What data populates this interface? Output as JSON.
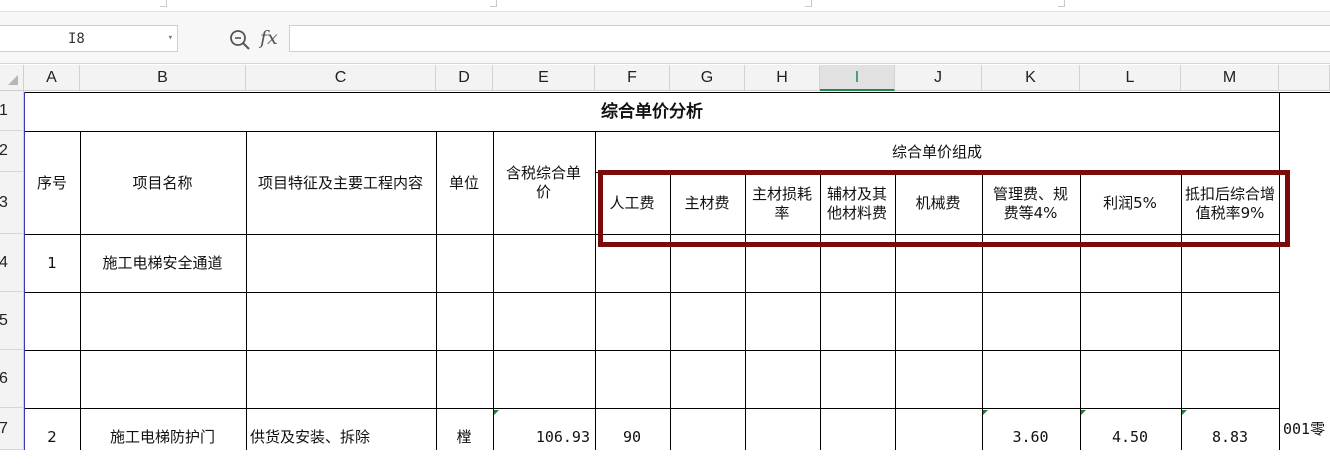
{
  "formula_bar": {
    "name_box": "I8",
    "fx_label": "fx",
    "formula": ""
  },
  "columns": [
    "A",
    "B",
    "C",
    "D",
    "E",
    "F",
    "G",
    "H",
    "I",
    "J",
    "K",
    "L",
    "M"
  ],
  "selected_column": "I",
  "rows": [
    "1",
    "2",
    "3",
    "4",
    "5",
    "6",
    "7"
  ],
  "sheet": {
    "title": "综合单价分析",
    "headers": {
      "seq": "序号",
      "name": "项目名称",
      "features": "项目特征及主要工程内容",
      "unit": "单位",
      "price": "含税综合单价",
      "composition": "综合单价组成",
      "labor": "人工费",
      "main_material": "主材费",
      "material_loss": "主材损耗率",
      "aux_material": "辅材及其他材料费",
      "machinery": "机械费",
      "management": "管理费、规费等4%",
      "profit": "利润5%",
      "vat": "抵扣后综合增值税率9%"
    },
    "row4": {
      "seq": "1",
      "name": "施工电梯安全通道"
    },
    "row7": {
      "seq": "2",
      "name": "施工电梯防护门",
      "features": "供货及安装、拆除",
      "unit": "樘",
      "price": "106.93",
      "labor": "90",
      "management": "3.60",
      "profit": "4.50",
      "vat": "8.83",
      "overflow": "001零"
    }
  },
  "colors": {
    "highlight_border": "#7a0b0b",
    "selected_header_text": "#1e8a4f",
    "grid": "#000000"
  }
}
